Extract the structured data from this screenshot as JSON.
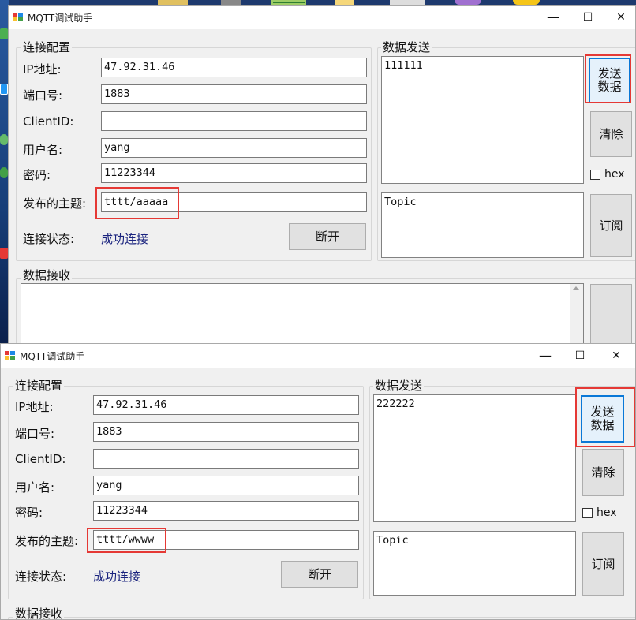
{
  "colors": {
    "desktop": "#1e3a6e",
    "highlight": "#e53935",
    "link": "#1a237e",
    "focus_border": "#0a78d7"
  },
  "windows": [
    {
      "title": "MQTT调试助手",
      "controls": {
        "minimize": "—",
        "maximize": "☐",
        "close": "✕"
      },
      "conn": {
        "legend": "连接配置",
        "ip_label": "IP地址:",
        "ip_value": "47.92.31.46",
        "port_label": "端口号:",
        "port_value": "1883",
        "clientid_label": "ClientID:",
        "clientid_value": "",
        "user_label": "用户名:",
        "user_value": "yang",
        "pwd_label": "密码:",
        "pwd_value": "11223344",
        "topic_label": "发布的主题:",
        "topic_value": "tttt/aaaaa",
        "status_label": "连接状态:",
        "status_value": "成功连接",
        "disconnect": "断开"
      },
      "send": {
        "legend": "数据发送",
        "text": "111111",
        "send_line1": "发送",
        "send_line2": "数据",
        "clear": "清除",
        "hex": "hex",
        "topic_text": "Topic",
        "subscribe": "订阅"
      },
      "recv": {
        "legend": "数据接收"
      }
    },
    {
      "title": "MQTT调试助手",
      "controls": {
        "minimize": "—",
        "maximize": "☐",
        "close": "✕"
      },
      "conn": {
        "legend": "连接配置",
        "ip_label": "IP地址:",
        "ip_value": "47.92.31.46",
        "port_label": "端口号:",
        "port_value": "1883",
        "clientid_label": "ClientID:",
        "clientid_value": "",
        "user_label": "用户名:",
        "user_value": "yang",
        "pwd_label": "密码:",
        "pwd_value": "11223344",
        "topic_label": "发布的主题:",
        "topic_value": "tttt/wwww",
        "status_label": "连接状态:",
        "status_value": "成功连接",
        "disconnect": "断开"
      },
      "send": {
        "legend": "数据发送",
        "text": "222222",
        "send_line1": "发送",
        "send_line2": "数据",
        "clear": "清除",
        "hex": "hex",
        "topic_text": "Topic",
        "subscribe": "订阅"
      },
      "recv": {
        "legend": "数据接收"
      }
    }
  ]
}
